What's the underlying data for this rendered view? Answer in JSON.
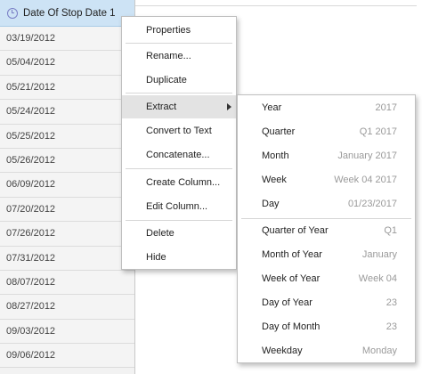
{
  "column": {
    "header": "Date Of Stop Date 1",
    "rows": [
      "03/19/2012",
      "05/04/2012",
      "05/21/2012",
      "05/24/2012",
      "05/25/2012",
      "05/26/2012",
      "06/09/2012",
      "07/20/2012",
      "07/26/2012",
      "07/31/2012",
      "08/07/2012",
      "08/27/2012",
      "09/03/2012",
      "09/06/2012"
    ]
  },
  "menu": {
    "items": [
      "Properties",
      "Rename...",
      "Duplicate",
      "Extract",
      "Convert to Text",
      "Concatenate...",
      "Create Column...",
      "Edit Column...",
      "Delete",
      "Hide"
    ],
    "active": "Extract"
  },
  "submenu": {
    "items": [
      {
        "label": "Year",
        "value": "2017"
      },
      {
        "label": "Quarter",
        "value": "Q1 2017"
      },
      {
        "label": "Month",
        "value": "January 2017"
      },
      {
        "label": "Week",
        "value": "Week 04 2017"
      },
      {
        "label": "Day",
        "value": "01/23/2017"
      },
      {
        "label": "Quarter of Year",
        "value": "Q1"
      },
      {
        "label": "Month of Year",
        "value": "January"
      },
      {
        "label": "Week of Year",
        "value": "Week 04"
      },
      {
        "label": "Day of Year",
        "value": "23"
      },
      {
        "label": "Day of Month",
        "value": "23"
      },
      {
        "label": "Weekday",
        "value": "Monday"
      }
    ]
  },
  "colors": {
    "header_bg": "#cde3f5",
    "clock_icon": "#7a7fc6",
    "menu_active_bg": "#e3e3e3"
  }
}
